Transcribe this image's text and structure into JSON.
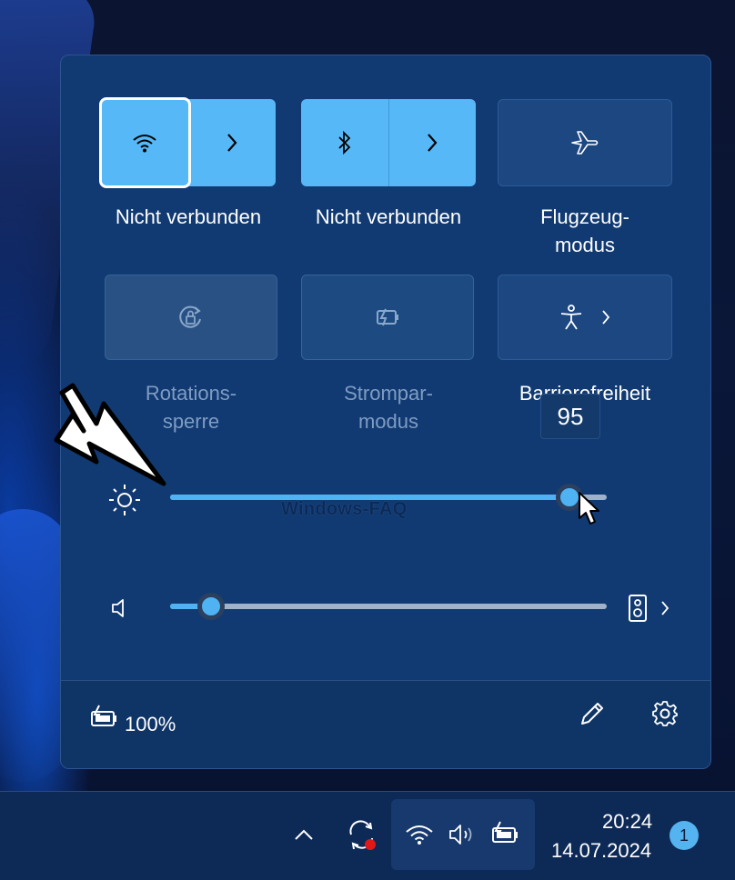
{
  "quick_settings": {
    "tiles": [
      {
        "id": "wifi",
        "label": "Nicht verbunden",
        "state": "on",
        "icon": "wifi-icon"
      },
      {
        "id": "bluetooth",
        "label": "Nicht verbunden",
        "state": "on",
        "icon": "bluetooth-icon"
      },
      {
        "id": "airplane",
        "label": "Flugzeug-\nmodus",
        "state": "off",
        "icon": "airplane-icon"
      },
      {
        "id": "rotation",
        "label": "Rotations-\nsperre",
        "state": "disabled",
        "icon": "rotation-lock-icon"
      },
      {
        "id": "battery_saver",
        "label": "Strompar-\nmodus",
        "state": "disabled",
        "icon": "battery-saver-icon"
      },
      {
        "id": "accessibility",
        "label": "Barrierefreiheit",
        "state": "off",
        "icon": "accessibility-icon"
      }
    ],
    "brightness": {
      "value": 95,
      "tooltip": "95",
      "icon": "brightness-icon"
    },
    "volume": {
      "value": 10,
      "icon": "speaker-icon",
      "output_icon": "speaker-device-icon"
    },
    "watermark": "Windows-FAQ",
    "footer": {
      "battery_label": "100%",
      "battery_icon": "battery-charging-icon",
      "edit_icon": "pencil-icon",
      "settings_icon": "gear-icon"
    }
  },
  "taskbar": {
    "time": "20:24",
    "date": "14.07.2024",
    "notification_count": "1",
    "tray_icons": [
      "chevron-up-icon",
      "sync-alert-icon",
      "wifi-icon",
      "speaker-icon",
      "battery-charging-icon"
    ]
  },
  "colors": {
    "accent": "#56b8f6",
    "panel": "#113a72",
    "taskbar": "#0d2a57"
  }
}
